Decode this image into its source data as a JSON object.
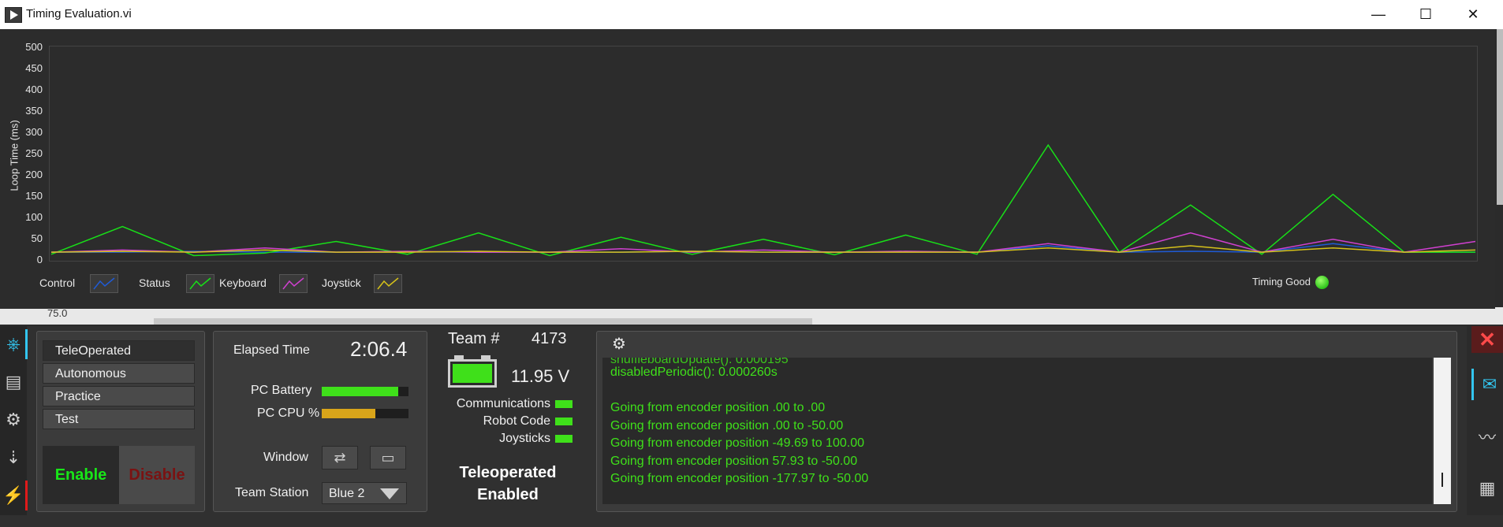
{
  "window": {
    "title": "Timing Evaluation.vi",
    "minimize": "—",
    "maximize": "☐",
    "close": "✕"
  },
  "background": {
    "tick_label": "75.0"
  },
  "timing_chart": {
    "ylabel": "Loop Time (ms)",
    "yticks": [
      "500",
      "450",
      "400",
      "350",
      "300",
      "250",
      "200",
      "150",
      "100",
      "50",
      "0"
    ],
    "legend": [
      {
        "label": "Control",
        "color": "#1f5bd6"
      },
      {
        "label": "Status",
        "color": "#18e018"
      },
      {
        "label": "Keyboard",
        "color": "#d040d0"
      },
      {
        "label": "Joystick",
        "color": "#d6c21a"
      }
    ],
    "timing_good_label": "Timing Good"
  },
  "chart_data": {
    "type": "line",
    "ylabel": "Loop Time (ms)",
    "ylim": [
      0,
      500
    ],
    "grid": false,
    "x": [
      0,
      5,
      10,
      15,
      20,
      25,
      30,
      35,
      40,
      45,
      50,
      55,
      60,
      65,
      70,
      75,
      80,
      85,
      90,
      95,
      100
    ],
    "series": [
      {
        "name": "Control",
        "color": "#1f5bd6",
        "values": [
          20,
          20,
          22,
          20,
          20,
          21,
          20,
          20,
          20,
          22,
          20,
          20,
          21,
          20,
          35,
          20,
          22,
          20,
          40,
          20,
          20
        ]
      },
      {
        "name": "Status",
        "color": "#18e018",
        "values": [
          15,
          80,
          12,
          18,
          45,
          15,
          65,
          12,
          55,
          15,
          50,
          14,
          60,
          15,
          270,
          20,
          130,
          15,
          155,
          20,
          20
        ]
      },
      {
        "name": "Keyboard",
        "color": "#d040d0",
        "values": [
          20,
          25,
          20,
          30,
          20,
          22,
          20,
          20,
          28,
          20,
          25,
          20,
          22,
          20,
          40,
          20,
          65,
          20,
          50,
          20,
          45
        ]
      },
      {
        "name": "Joystick",
        "color": "#d6c21a",
        "values": [
          20,
          22,
          20,
          25,
          20,
          20,
          22,
          20,
          20,
          22,
          20,
          20,
          20,
          20,
          30,
          20,
          35,
          20,
          30,
          20,
          25
        ]
      }
    ]
  },
  "driver_station": {
    "modes": [
      "TeleOperated",
      "Autonomous",
      "Practice",
      "Test"
    ],
    "enable": "Enable",
    "disable": "Disable",
    "elapsed_label": "Elapsed Time",
    "elapsed_value": "2:06.4",
    "pc_battery_label": "PC Battery",
    "pc_battery_level": 0.88,
    "pc_cpu_label": "PC CPU %",
    "pc_cpu_level": 0.62,
    "window_label": "Window",
    "team_station_label": "Team Station",
    "team_station_value": "Blue 2",
    "team_label": "Team #",
    "team_number": "4173",
    "voltage": "11.95 V",
    "indicators": [
      "Communications",
      "Robot Code",
      "Joysticks"
    ],
    "mode_status_line1": "Teleoperated",
    "mode_status_line2": "Enabled"
  },
  "console": {
    "lines": [
      "disabledPeriodic(): 0.000260s",
      "",
      "Going from encoder position .00 to .00",
      "Going from encoder position .00 to -50.00",
      "Going from encoder position -49.69 to 100.00",
      "Going from encoder position 57.93 to -50.00",
      "Going from encoder position -177.97 to -50.00"
    ]
  }
}
